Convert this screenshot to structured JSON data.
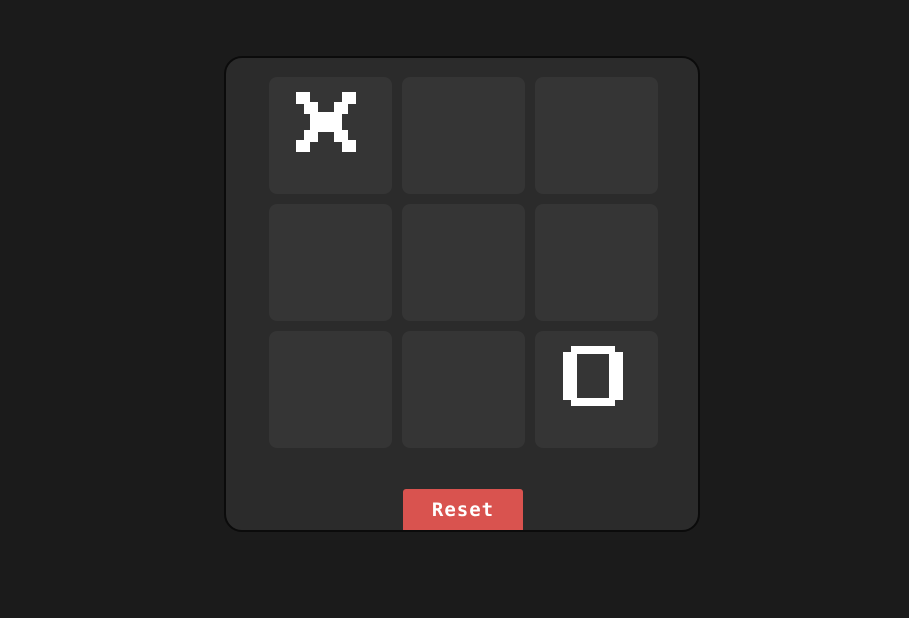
{
  "game": {
    "board": [
      "X",
      "",
      "",
      "",
      "",
      "",
      "",
      "",
      "O"
    ],
    "reset_label": "Reset"
  },
  "colors": {
    "page_background": "#1b1b1b",
    "panel_background": "#2b2b2b",
    "cell_background": "#353535",
    "mark_color": "#ffffff",
    "reset_button": "#d9534f"
  },
  "icons": {
    "x_mark": "x-mark-icon",
    "o_mark": "o-mark-icon"
  }
}
